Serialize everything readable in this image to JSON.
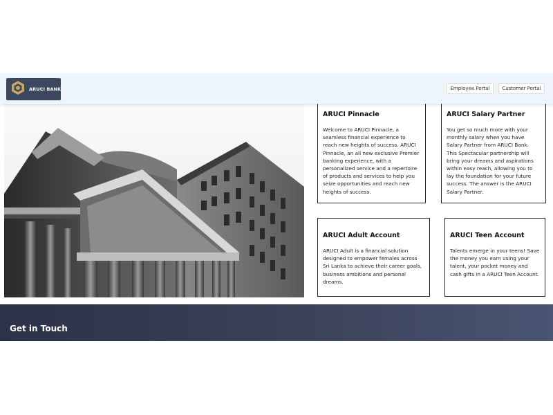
{
  "header": {
    "brand_name": "ARUCI BANK",
    "logo_icon": "hexagon-logo-icon",
    "employee_portal_label": "Employee Portal",
    "customer_portal_label": "Customer Portal",
    "brand_bg": "#3d4760",
    "logo_accent": "#c9a75c"
  },
  "hero": {
    "image": "bank-building-photo"
  },
  "cards": [
    {
      "title": "ARUCI Pinnacle",
      "body": "Welcome to ARUCI Pinnacle, a seamless financial experience to reach new heights of success. ARUCI Pinnacle, an all new exclusive Premier banking experience, with a personalized service and a repertoire of products and services to help you seize opportunities and reach new heights of success."
    },
    {
      "title": "ARUCI Salary Partner",
      "body": "You get so much more with your monthly salary when you have Salary Partner from ARUCI Bank. This Spectacular partnership will bring your dreams and aspirations within easy reach, allowing you to lay the foundation for your future success. The answer is the ARUCI Salary Partner."
    },
    {
      "title": "ARUCI Adult Account",
      "body": "ARUCI Adult is a financial solution designed to empower females across Sri Lanka to achieve their career goals, business ambitions and personal dreams."
    },
    {
      "title": "ARUCI Teen Account",
      "body": "Talents emerge in your teens! Save the money you earn using your talent, your pocket money and cash gifts in a ARUCI Teen Account."
    }
  ],
  "footer": {
    "title": "Get in Touch"
  }
}
